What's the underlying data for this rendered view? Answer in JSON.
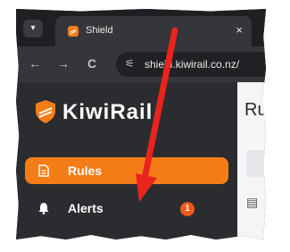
{
  "browser": {
    "tab_title": "Shield",
    "tab_list_icon": "chevron-down-icon",
    "close_glyph": "×",
    "url": "shield.kiwirail.co.nz/",
    "back_glyph": "←",
    "forward_glyph": "→",
    "reload_glyph": "C",
    "site_info_glyph": "⚟"
  },
  "app": {
    "brand": "KiwiRail",
    "brand_color": "#f57d17",
    "page_title": "Ru"
  },
  "sidebar": {
    "items": [
      {
        "label": "Rules",
        "icon": "document-icon",
        "active": true
      },
      {
        "label": "Alerts",
        "icon": "bell-icon",
        "badge": "1"
      }
    ]
  },
  "annotation": {
    "arrow_color": "#e8241c",
    "arrow_icon": "red-arrow-annotation"
  }
}
